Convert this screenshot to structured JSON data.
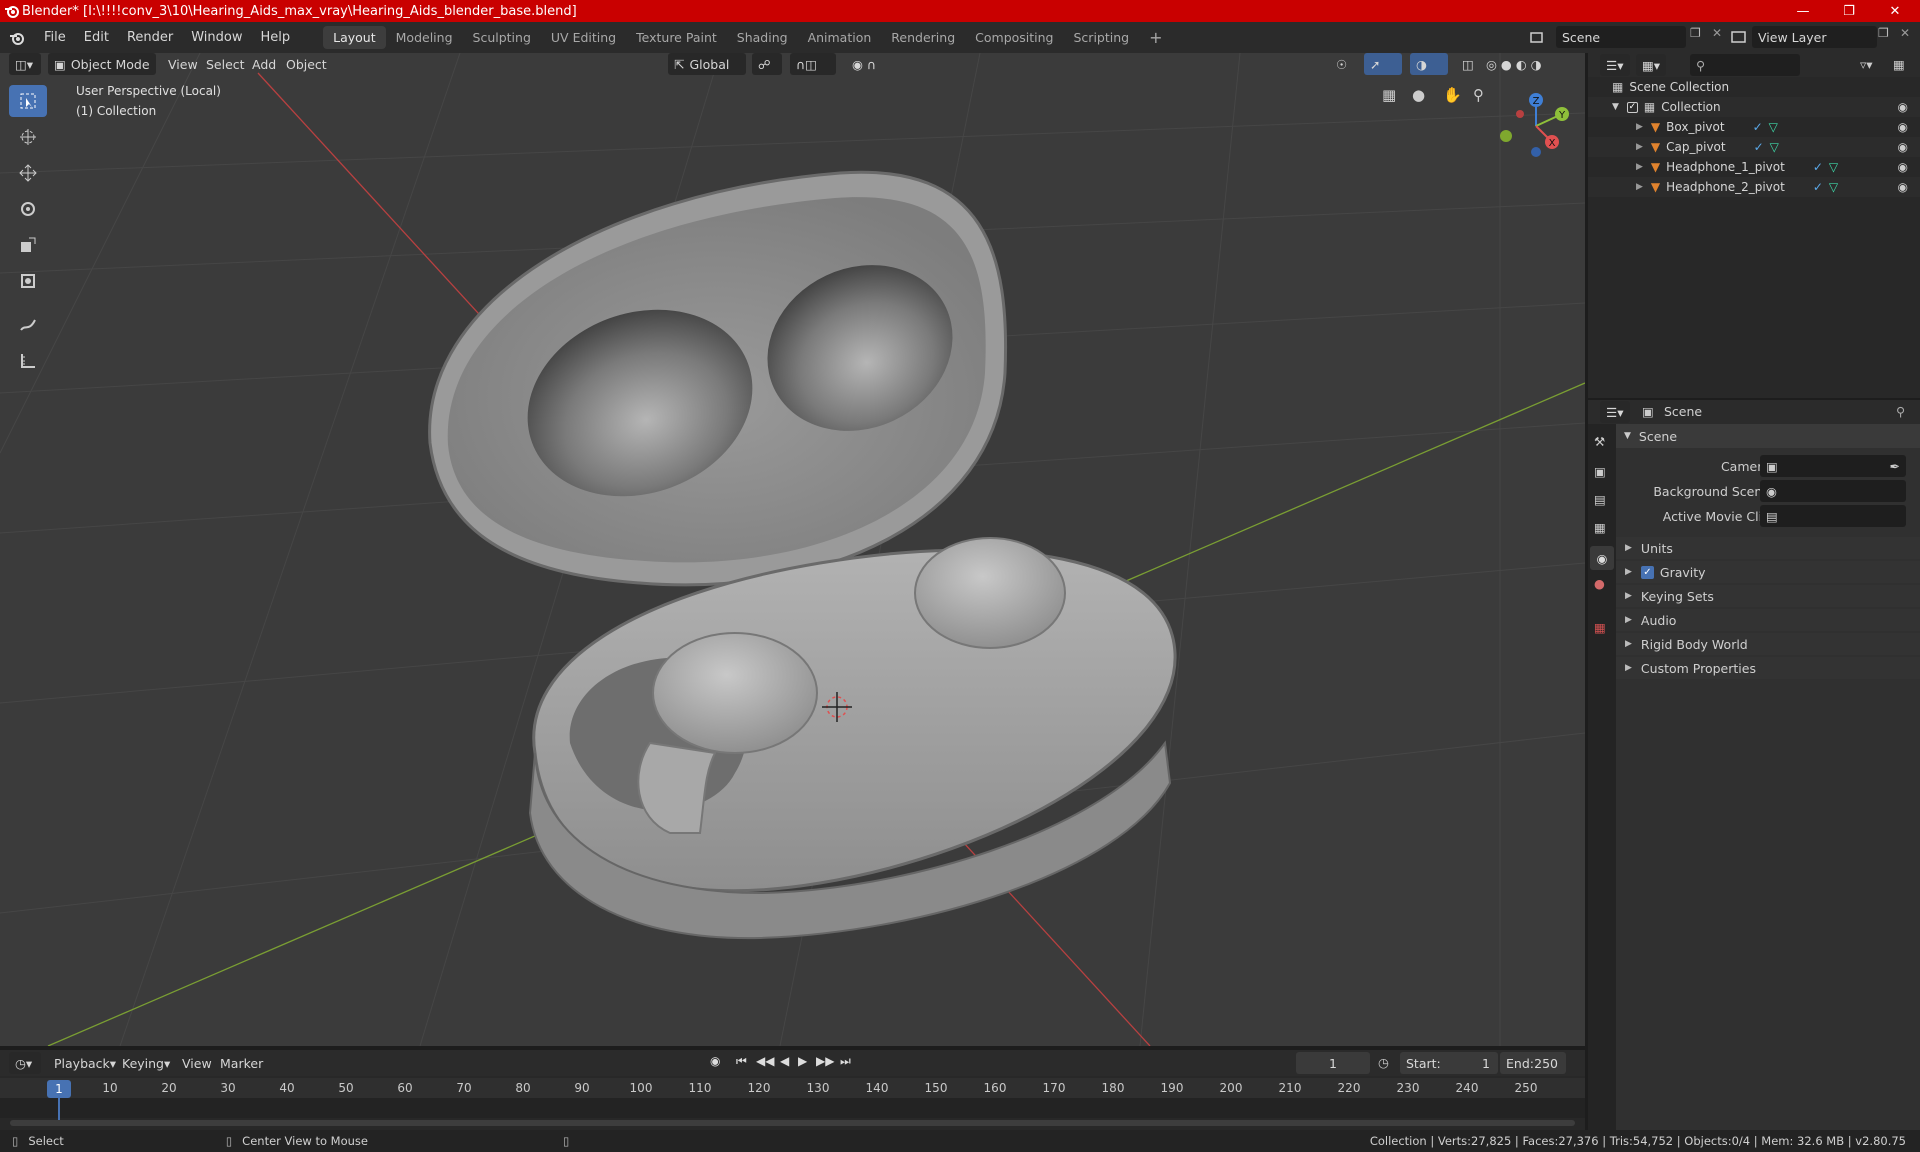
{
  "window": {
    "title": "Blender* [I:\\!!!!conv_3\\10\\Hearing_Aids_max_vray\\Hearing_Aids_blender_base.blend]",
    "controls": [
      "minimize-icon",
      "maximize-icon",
      "close-icon"
    ]
  },
  "menu": {
    "items": [
      "File",
      "Edit",
      "Render",
      "Window",
      "Help"
    ],
    "workspaces": [
      "Layout",
      "Modeling",
      "Sculpting",
      "UV Editing",
      "Texture Paint",
      "Shading",
      "Animation",
      "Rendering",
      "Compositing",
      "Scripting"
    ],
    "active_workspace": "Layout",
    "add_workspace": "+",
    "scene": "Scene",
    "view_layer": "View Layer"
  },
  "viewport": {
    "mode": "Object Mode",
    "menus": [
      "View",
      "Select",
      "Add",
      "Object"
    ],
    "orientation": "Global",
    "overlay_text_1": "User Perspective (Local)",
    "overlay_text_2": "(1) Collection",
    "gizmo": {
      "x": "X",
      "y": "Y",
      "z": "Z"
    }
  },
  "outliner": {
    "root": "Scene Collection",
    "collection": "Collection",
    "objects": [
      "Box_pivot",
      "Cap_pivot",
      "Headphone_1_pivot",
      "Headphone_2_pivot"
    ]
  },
  "properties": {
    "header": "Scene",
    "panel": "Scene",
    "camera_label": "Camera",
    "background_scene_label": "Background Scene",
    "active_movie_clip_label": "Active Movie Clip",
    "sections": [
      "Units",
      "Gravity",
      "Keying Sets",
      "Audio",
      "Rigid Body World",
      "Custom Properties"
    ],
    "gravity_checked": true
  },
  "timeline": {
    "menus": [
      "Playback",
      "Keying",
      "View",
      "Marker"
    ],
    "current_frame": "1",
    "start_label": "Start:",
    "start_value": "1",
    "end_label": "End:",
    "end_value": "250",
    "ticks": [
      "1",
      "10",
      "20",
      "30",
      "40",
      "50",
      "60",
      "70",
      "80",
      "90",
      "100",
      "110",
      "120",
      "130",
      "140",
      "150",
      "160",
      "170",
      "180",
      "190",
      "200",
      "210",
      "220",
      "230",
      "240",
      "250"
    ]
  },
  "status": {
    "left_action": "Select",
    "middle_action": "Center View to Mouse",
    "stats": "Collection | Verts:27,825 | Faces:27,376 | Tris:54,752 | Objects:0/4 | Mem: 32.6 MB | v2.80.75"
  },
  "colors": {
    "accent": "#4772b3",
    "title_bar": "#c90000",
    "x_axis": "#e05050",
    "y_axis": "#8fc03a",
    "z_axis": "#3f7fd6",
    "mesh_icon": "#e0832e",
    "modifier_icon": "#5aa8e8",
    "data_icon": "#3fd9a8"
  }
}
